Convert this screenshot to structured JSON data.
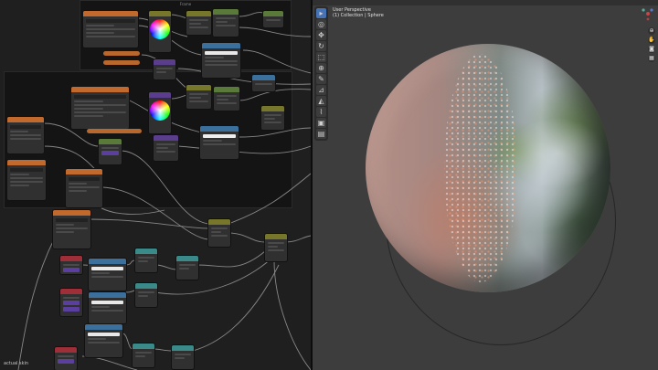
{
  "node_editor": {
    "status_text": "actual skin",
    "frame_label": "Frame"
  },
  "viewport": {
    "view_name": "User Perspective",
    "collection": "(1) Collection | Sphere"
  },
  "toolbar": {
    "tools": [
      {
        "name": "select-icon",
        "glyph": "▸"
      },
      {
        "name": "cursor-icon",
        "glyph": "◎"
      },
      {
        "name": "move-icon",
        "glyph": "✥"
      },
      {
        "name": "rotate-icon",
        "glyph": "↻"
      },
      {
        "name": "scale-icon",
        "glyph": "⬚"
      },
      {
        "name": "transform-icon",
        "glyph": "⊕"
      },
      {
        "name": "annotate-icon",
        "glyph": "✎"
      },
      {
        "name": "measure-icon",
        "glyph": "⊿"
      },
      {
        "name": "shade-icon",
        "glyph": "◭"
      },
      {
        "name": "brush-icon",
        "glyph": "⌇"
      },
      {
        "name": "cube-icon",
        "glyph": "▣"
      },
      {
        "name": "sample-icon",
        "glyph": "▤"
      }
    ]
  },
  "nav_buttons": [
    {
      "name": "zoom-icon",
      "glyph": "⊕"
    },
    {
      "name": "hand-icon",
      "glyph": "✋"
    },
    {
      "name": "camera-icon",
      "glyph": "◙"
    },
    {
      "name": "grid-icon",
      "glyph": "▦"
    }
  ],
  "colors": {
    "node_orange": "#c26a2e",
    "node_blue": "#3b6f9c",
    "node_green": "#5a7a3a",
    "node_olive": "#77772b",
    "node_red": "#9e2f38",
    "node_purple": "#5b3d8e",
    "active_tool": "#4772b3"
  }
}
